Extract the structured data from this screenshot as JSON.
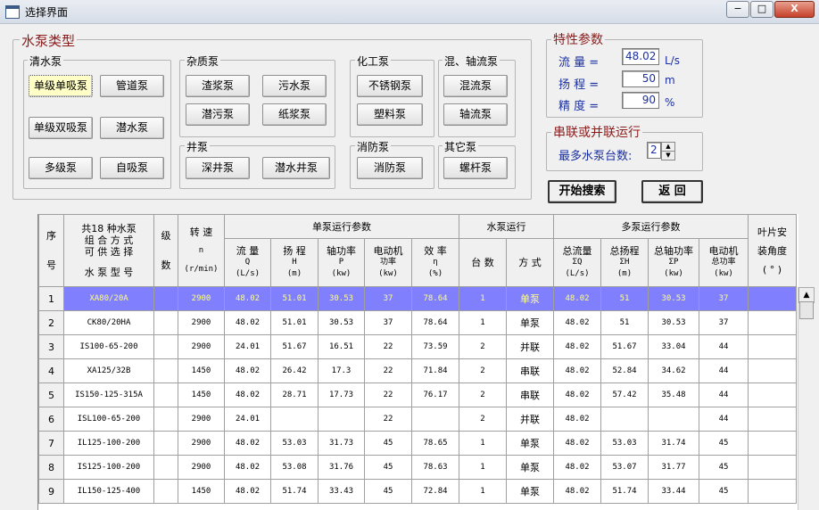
{
  "window": {
    "title": "选择界面",
    "minimize": "−",
    "maximize": "□",
    "close": "X"
  },
  "pump_types": {
    "legend": "水泵类型",
    "clear": {
      "legend": "清水泵",
      "buttons": [
        "单级单吸泵",
        "管道泵",
        "单级双吸泵",
        "潜水泵",
        "多级泵",
        "自吸泵"
      ]
    },
    "impurity": {
      "legend": "杂质泵",
      "buttons": [
        "渣浆泵",
        "污水泵",
        "潜污泵",
        "纸浆泵"
      ]
    },
    "well": {
      "legend": "井泵",
      "buttons": [
        "深井泵",
        "潜水井泵"
      ]
    },
    "chemical": {
      "legend": "化工泵",
      "buttons": [
        "不锈钢泵",
        "塑料泵"
      ]
    },
    "fire": {
      "legend": "消防泵",
      "buttons": [
        "消防泵"
      ]
    },
    "mixed": {
      "legend": "混、轴流泵",
      "buttons": [
        "混流泵",
        "轴流泵"
      ]
    },
    "other": {
      "legend": "其它泵",
      "buttons": [
        "螺杆泵"
      ]
    }
  },
  "params": {
    "legend": "特性参数",
    "flow_label": "流  量 =",
    "flow_value": "48.02",
    "flow_unit": "L/s",
    "head_label": "扬  程 =",
    "head_value": "50",
    "head_unit": "m",
    "precision_label": "精  度 =",
    "precision_value": "90",
    "precision_unit": "%"
  },
  "series": {
    "legend": "串联或并联运行",
    "max_label": "最多水泵台数:",
    "max_value": "2",
    "up": "▲",
    "down": "▼"
  },
  "actions": {
    "search": "开始搜索",
    "back": "返  回"
  },
  "table": {
    "h_seq_top": "序",
    "h_seq_bot": "号",
    "h_model_top1": "共18 种水泵",
    "h_model_top2": "组 合 方 式",
    "h_model_top3": "可 供 选 择",
    "h_model_bot": "水 泵 型 号",
    "h_stage_top": "级",
    "h_stage_bot": "数",
    "h_speed_top": "转  速",
    "h_speed_mid": "n",
    "h_speed_bot": "(r/min)",
    "h_single": "单泵运行参数",
    "h_run": "水泵运行",
    "h_multi": "多泵运行参数",
    "h_blade_top": "叶片安",
    "h_blade_mid": "装角度",
    "h_blade_bot": "( ° )",
    "sub": [
      {
        "l1": "流  量",
        "l2": "Q",
        "l3": "(L/s)"
      },
      {
        "l1": "扬  程",
        "l2": "H",
        "l3": "(m)"
      },
      {
        "l1": "轴功率",
        "l2": "P",
        "l3": "(kw)"
      },
      {
        "l1": "电动机",
        "l2": "功率",
        "l3": "(kw)"
      },
      {
        "l1": "效  率",
        "l2": "η",
        "l3": "(%)"
      },
      {
        "l1": "台  数",
        "l2": "",
        "l3": ""
      },
      {
        "l1": "方  式",
        "l2": "",
        "l3": ""
      },
      {
        "l1": "总流量",
        "l2": "ΣQ",
        "l3": "(L/s)"
      },
      {
        "l1": "总扬程",
        "l2": "ΣH",
        "l3": "(m)"
      },
      {
        "l1": "总轴功率",
        "l2": "ΣP",
        "l3": "(kw)"
      },
      {
        "l1": "电动机",
        "l2": "总功率",
        "l3": "(kw)"
      }
    ],
    "rows": [
      [
        "1",
        "XA80/20A",
        "",
        "2900",
        "48.02",
        "51.01",
        "30.53",
        "37",
        "78.64",
        "1",
        "单泵",
        "48.02",
        "51",
        "30.53",
        "37",
        ""
      ],
      [
        "2",
        "CK80/20HA",
        "",
        "2900",
        "48.02",
        "51.01",
        "30.53",
        "37",
        "78.64",
        "1",
        "单泵",
        "48.02",
        "51",
        "30.53",
        "37",
        ""
      ],
      [
        "3",
        "IS100-65-200",
        "",
        "2900",
        "24.01",
        "51.67",
        "16.51",
        "22",
        "73.59",
        "2",
        "并联",
        "48.02",
        "51.67",
        "33.04",
        "44",
        ""
      ],
      [
        "4",
        "XA125/32B",
        "",
        "1450",
        "48.02",
        "26.42",
        "17.3",
        "22",
        "71.84",
        "2",
        "串联",
        "48.02",
        "52.84",
        "34.62",
        "44",
        ""
      ],
      [
        "5",
        "IS150-125-315A",
        "",
        "1450",
        "48.02",
        "28.71",
        "17.73",
        "22",
        "76.17",
        "2",
        "串联",
        "48.02",
        "57.42",
        "35.48",
        "44",
        ""
      ],
      [
        "6",
        "ISL100-65-200",
        "",
        "2900",
        "24.01",
        "",
        "",
        "22",
        "",
        "2",
        "并联",
        "48.02",
        "",
        "",
        "44",
        ""
      ],
      [
        "7",
        "IL125-100-200",
        "",
        "2900",
        "48.02",
        "53.03",
        "31.73",
        "45",
        "78.65",
        "1",
        "单泵",
        "48.02",
        "53.03",
        "31.74",
        "45",
        ""
      ],
      [
        "8",
        "IS125-100-200",
        "",
        "2900",
        "48.02",
        "53.08",
        "31.76",
        "45",
        "78.63",
        "1",
        "单泵",
        "48.02",
        "53.07",
        "31.77",
        "45",
        ""
      ],
      [
        "9",
        "IL150-125-400",
        "",
        "1450",
        "48.02",
        "51.74",
        "33.43",
        "45",
        "72.84",
        "1",
        "单泵",
        "48.02",
        "51.74",
        "33.44",
        "45",
        ""
      ]
    ]
  },
  "scroll": {
    "up": "▲"
  }
}
